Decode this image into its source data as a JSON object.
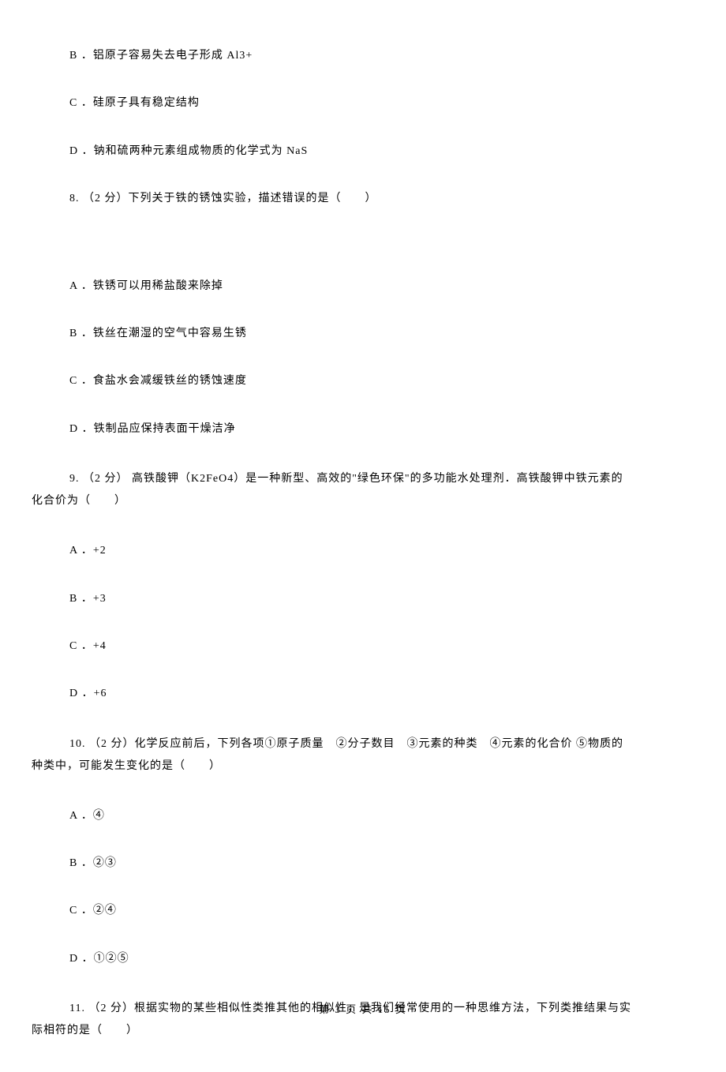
{
  "items": [
    {
      "type": "option",
      "label": "B ．",
      "text": "铝原子容易失去电子形成 Al3+"
    },
    {
      "type": "option",
      "label": "C ．",
      "text": "硅原子具有稳定结构"
    },
    {
      "type": "option",
      "label": "D ．",
      "text": "钠和硫两种元素组成物质的化学式为 NaS"
    },
    {
      "type": "question",
      "label": "8. ",
      "points": "（2 分）",
      "text": "下列关于铁的锈蚀实验，描述错误的是（　　）"
    },
    {
      "type": "spacer"
    },
    {
      "type": "option",
      "label": "A ．",
      "text": "铁锈可以用稀盐酸来除掉"
    },
    {
      "type": "option",
      "label": "B ．",
      "text": "铁丝在潮湿的空气中容易生锈"
    },
    {
      "type": "option",
      "label": "C ．",
      "text": "食盐水会减缓铁丝的锈蚀速度"
    },
    {
      "type": "option",
      "label": "D ．",
      "text": "铁制品应保持表面干燥洁净"
    },
    {
      "type": "question-multiline",
      "line1": "9. （2 分）  高铁酸钾（K2FeO4）是一种新型、高效的\"绿色环保\"的多功能水处理剂．高铁酸钾中铁元素的",
      "line2": "化合价为（　　）"
    },
    {
      "type": "option",
      "label": "A ．",
      "text": "+2"
    },
    {
      "type": "option",
      "label": "B ．",
      "text": "+3"
    },
    {
      "type": "option",
      "label": "C ．",
      "text": "+4"
    },
    {
      "type": "option",
      "label": "D ．",
      "text": "+6"
    },
    {
      "type": "question-multiline",
      "line1": "10. （2 分）化学反应前后，下列各项①原子质量　②分子数目　③元素的种类　④元素的化合价 ⑤物质的",
      "line2": "种类中，可能发生变化的是（　　）"
    },
    {
      "type": "option",
      "label": "A ．",
      "text": "④"
    },
    {
      "type": "option",
      "label": "B ．",
      "text": "②③"
    },
    {
      "type": "option",
      "label": "C ．",
      "text": "②④"
    },
    {
      "type": "option",
      "label": "D ．",
      "text": "①②⑤"
    },
    {
      "type": "question-multiline",
      "line1": "11. （2 分）根据实物的某些相似性类推其他的相似性，是我们经常使用的一种思维方法，下列类推结果与实",
      "line2": "际相符的是（　　）"
    }
  ],
  "footer": {
    "page_current": "3",
    "page_total": "15",
    "prefix": "第",
    "mid": "页 共",
    "suffix": "页"
  }
}
